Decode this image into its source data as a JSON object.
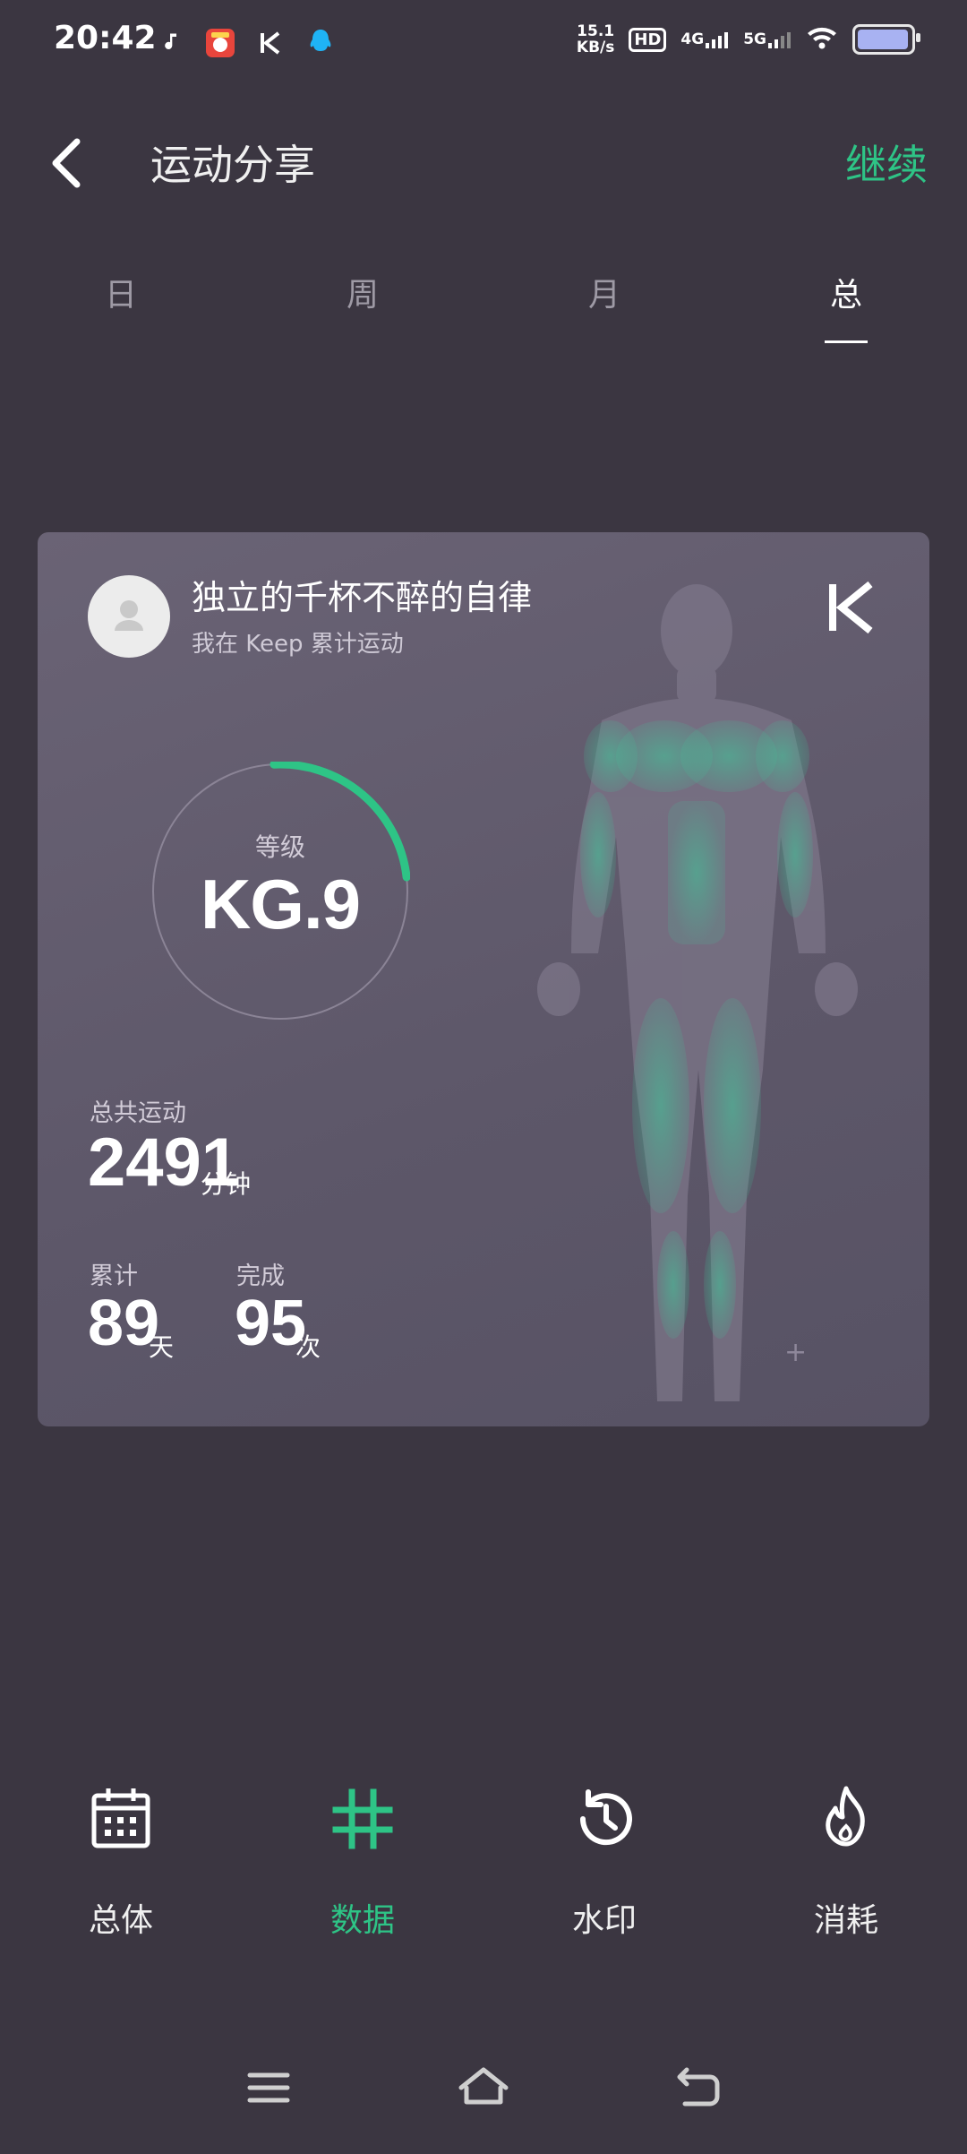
{
  "status_bar": {
    "time": "20:42",
    "net_speed_value": "15.1",
    "net_speed_unit": "KB/s",
    "hd_badge": "HD",
    "sim1": "4G",
    "sim2": "5G"
  },
  "header": {
    "title": "运动分享",
    "continue_label": "继续"
  },
  "tabs": [
    {
      "label": "日",
      "active": false
    },
    {
      "label": "周",
      "active": false
    },
    {
      "label": "月",
      "active": false
    },
    {
      "label": "总",
      "active": true
    }
  ],
  "card": {
    "username": "独立的千杯不醉的自律",
    "subtitle": "我在 Keep 累计运动",
    "level_label": "等级",
    "level_value": "KG.9",
    "level_progress": 0.24,
    "total_label": "总共运动",
    "total_value": "2491",
    "total_unit": "分钟",
    "days_label": "累计",
    "days_value": "89",
    "days_unit": "天",
    "sessions_label": "完成",
    "sessions_value": "95",
    "sessions_unit": "次"
  },
  "toolbar": [
    {
      "label": "总体",
      "icon": "calendar-icon",
      "active": false
    },
    {
      "label": "数据",
      "icon": "hashtag-icon",
      "active": true
    },
    {
      "label": "水印",
      "icon": "history-icon",
      "active": false
    },
    {
      "label": "消耗",
      "icon": "flame-icon",
      "active": false
    }
  ],
  "colors": {
    "accent": "#2ec486",
    "background": "#3b3641",
    "card": "#5f596b"
  }
}
